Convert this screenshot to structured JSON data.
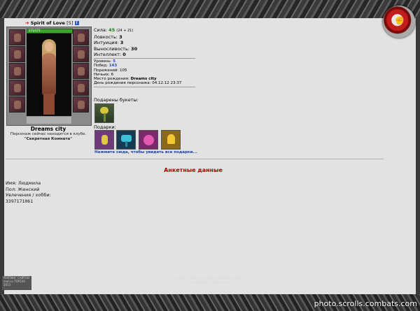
{
  "character": {
    "name": "Spirit of Love",
    "level": "[5]",
    "info_badge": "i",
    "hp_text": "171/171",
    "location": "Dreams city",
    "club_line1": "Персонаж сейчас находится в клубе.",
    "club_name": "\"Секретная Комната\""
  },
  "stats": [
    {
      "label": "Сила:",
      "value": "45",
      "extra": "(24 + 21)"
    },
    {
      "label": "Ловкость:",
      "value": "3",
      "extra": ""
    },
    {
      "label": "Интуиция:",
      "value": "3",
      "extra": ""
    },
    {
      "label": "Выносливость:",
      "value": "30",
      "extra": ""
    },
    {
      "label": "Интеллект:",
      "value": "0",
      "extra": ""
    }
  ],
  "info": {
    "level_label": "Уровень:",
    "level_value": "5",
    "wins_label": "Побед:",
    "wins_value": "143",
    "losses": "Поражений: 105",
    "draws": "Ничьих: 6",
    "birthplace_label": "Место рождения:",
    "birthplace_value": "Dreams city",
    "birthday": "День рождения персонажа: 04.12.12 23:37"
  },
  "gifts": {
    "bouquets_label": "Подарены букеты:",
    "gifts_label": "Подарки:",
    "link_text": "Нажмите сюда, чтобы увидеть все подарки..."
  },
  "profile": {
    "section_title": "Анкетные данные",
    "name_line": "Имя: Людмила",
    "gender_line": "Пол: Женский",
    "hobbies_line": "Увлечения / хобби:",
    "phone": "3397171061"
  },
  "footer": {
    "copyright_line1": "© 2002 - 2012, «www.Combats.com»™",
    "copyright_line2": "All rights reserved",
    "logo_line1": "РЕЙТИНГ САЙТОВ",
    "logo_line2": "mail.ru  TOP100",
    "logo_line3": "2013"
  },
  "watermark": "photo.scrolls.combats.com",
  "colors": {
    "accent_red": "#aa0000",
    "link_blue": "#1b3f9e",
    "stat_green": "#1b7a1b"
  }
}
